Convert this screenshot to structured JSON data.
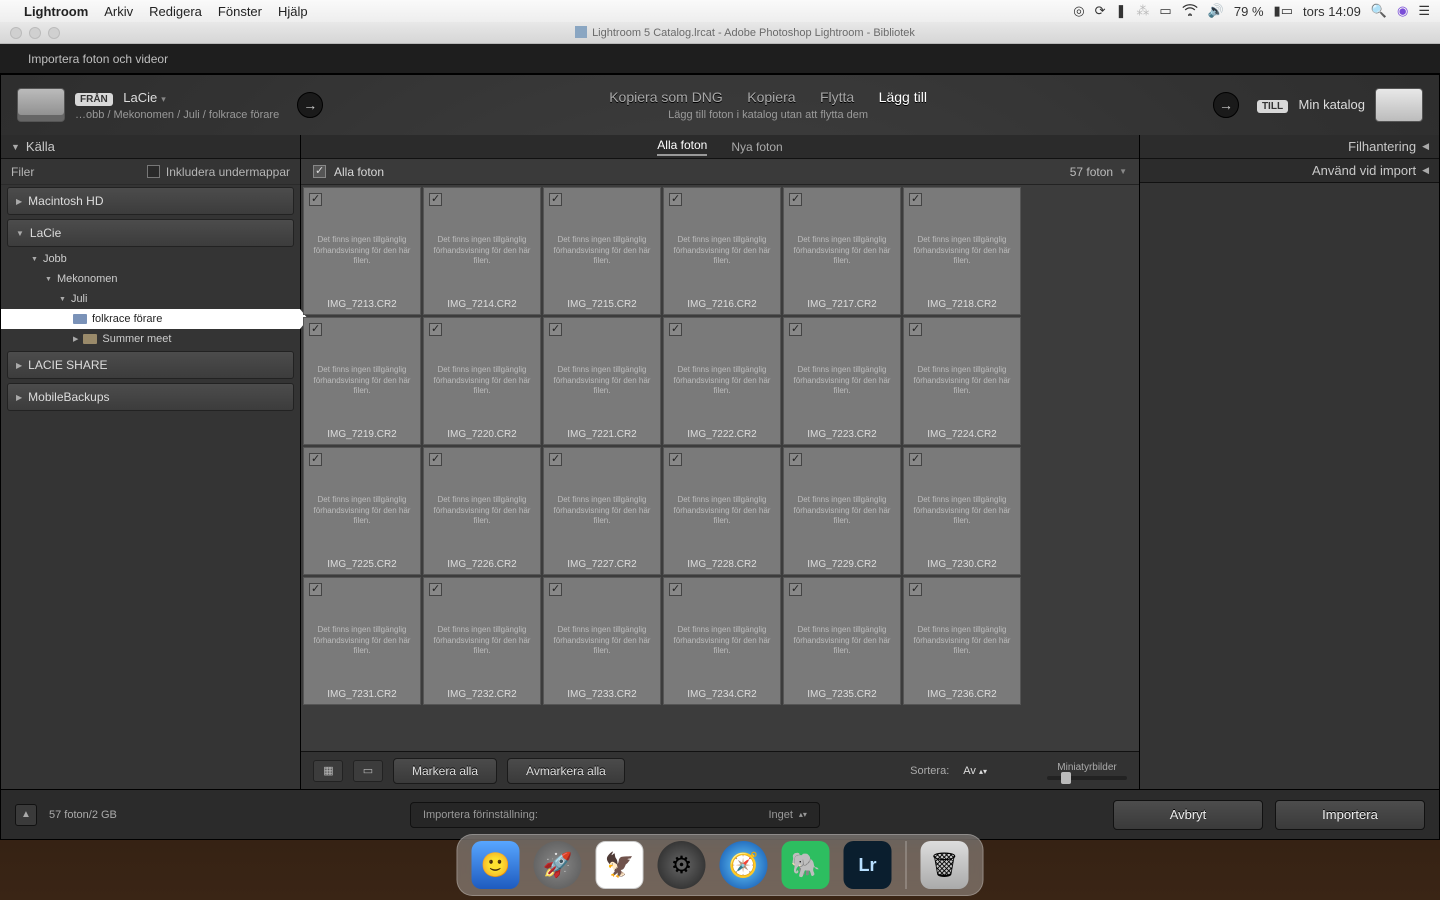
{
  "menubar": {
    "app": "Lightroom",
    "items": [
      "Arkiv",
      "Redigera",
      "Fönster",
      "Hjälp"
    ],
    "battery": "79 %",
    "clock": "tors 14:09"
  },
  "titlebar": {
    "title": "Lightroom 5 Catalog.lrcat - Adobe Photoshop Lightroom - Bibliotek"
  },
  "tabstrip": {
    "tab1": "Importera foton och videor"
  },
  "srcbar": {
    "from_label": "FRÅN",
    "source_name": "LaCie",
    "source_path": "…obb / Mekonomen / Juli / folkrace förare",
    "mode_dng": "Kopiera som DNG",
    "mode_copy": "Kopiera",
    "mode_move": "Flytta",
    "mode_add": "Lägg till",
    "mode_sub": "Lägg till foton i katalog utan att flytta dem",
    "to_label": "TILL",
    "to_name": "Min katalog"
  },
  "left": {
    "source": "Källa",
    "files": "Filer",
    "include_sub": "Inkludera undermappar",
    "drives": [
      "Macintosh HD",
      "LaCie",
      "LACIE SHARE",
      "MobileBackups"
    ],
    "jobb": "Jobb",
    "mek": "Mekonomen",
    "juli": "Juli",
    "sel": "folkrace förare",
    "summer": "Summer meet"
  },
  "right": {
    "p1": "Filhantering",
    "p2": "Använd vid import"
  },
  "center": {
    "tab_all": "Alla foton",
    "tab_new": "Nya foton",
    "header": "Alla foton",
    "count": "57 foton",
    "nopreview": "Det finns ingen tillgänglig förhandsvisning för den här filen.",
    "files": [
      "IMG_7213.CR2",
      "IMG_7214.CR2",
      "IMG_7215.CR2",
      "IMG_7216.CR2",
      "IMG_7217.CR2",
      "IMG_7218.CR2",
      "IMG_7219.CR2",
      "IMG_7220.CR2",
      "IMG_7221.CR2",
      "IMG_7222.CR2",
      "IMG_7223.CR2",
      "IMG_7224.CR2",
      "IMG_7225.CR2",
      "IMG_7226.CR2",
      "IMG_7227.CR2",
      "IMG_7228.CR2",
      "IMG_7229.CR2",
      "IMG_7230.CR2",
      "IMG_7231.CR2",
      "IMG_7232.CR2",
      "IMG_7233.CR2",
      "IMG_7234.CR2",
      "IMG_7235.CR2",
      "IMG_7236.CR2"
    ]
  },
  "ctoolbar": {
    "checkall": "Markera alla",
    "uncheckall": "Avmarkera alla",
    "sort_label": "Sortera:",
    "sort_value": "Av",
    "thumbsize": "Miniatyrbilder"
  },
  "bottom": {
    "status": "57 foton/2 GB",
    "preset_label": "Importera förinställning:",
    "preset_value": "Inget",
    "cancel": "Avbryt",
    "import": "Importera"
  }
}
